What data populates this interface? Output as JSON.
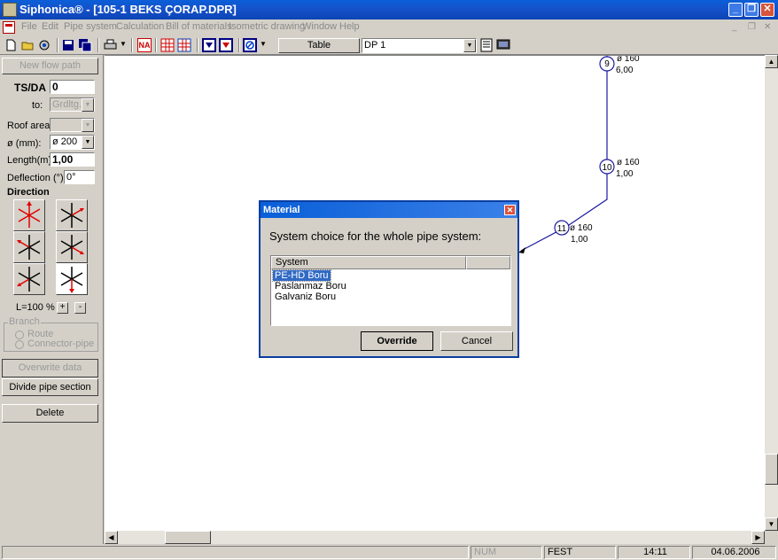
{
  "window": {
    "title": "Siphonica® - [105-1 BEKS ÇORAP.DPR]",
    "controls": {
      "minimize": "_",
      "maximize": "❐",
      "close": "✕"
    }
  },
  "menu": [
    "File",
    "Edit",
    "Pipe system",
    "Calculation",
    "Bill of materials",
    "Isometric drawing",
    "Window",
    "Help"
  ],
  "toolbar": {
    "table_label": "Table",
    "dp_select_value": "DP 1",
    "na_label": "NA"
  },
  "left_panel": {
    "new_flow_path": "New flow path",
    "ts_da_label": "TS/DA",
    "ts_da_value": "0",
    "to_label": "to:",
    "to_value": "Grdltg.",
    "roof_area_label": "Roof area:",
    "roof_area_value": "",
    "diameter_label": "ø (mm):",
    "diameter_value": "ø 200",
    "length_label": "Length(m) :",
    "length_value": "1,00",
    "deflection_label": "Deflection (°):",
    "deflection_value": "0°",
    "direction_label": "Direction",
    "zoom_label": "L=100 %",
    "plus": "+",
    "minus": "-",
    "branch_label": "Branch",
    "route_label": "Route",
    "connector_label": "Connector-pipe",
    "overwrite_data": "Overwrite data",
    "divide_pipe_section": "Divide pipe section",
    "delete": "Delete"
  },
  "drawing": {
    "nodes": [
      {
        "id": "9",
        "dia": "ø 160",
        "len": "6,00"
      },
      {
        "id": "10",
        "dia": "ø 160",
        "len": "1,00"
      },
      {
        "id": "11",
        "dia": "ø 160",
        "len": "1,00"
      }
    ]
  },
  "dialog": {
    "title": "Material",
    "prompt": "System choice for the whole pipe system:",
    "column": "System",
    "items": [
      "PE-HD Boru",
      "Paslanmaz Boru",
      "Galvaniz Boru"
    ],
    "selected_index": 0,
    "override_label": "Override",
    "cancel_label": "Cancel"
  },
  "status": {
    "num": "NUM",
    "fest": "FEST",
    "time": "14:11",
    "date": "04.06.2006"
  },
  "colors": {
    "titlebar": "#0a5fd8",
    "pipe_line": "#1a1aa0",
    "selection": "#316ac5",
    "arrow_red": "#e00000"
  }
}
